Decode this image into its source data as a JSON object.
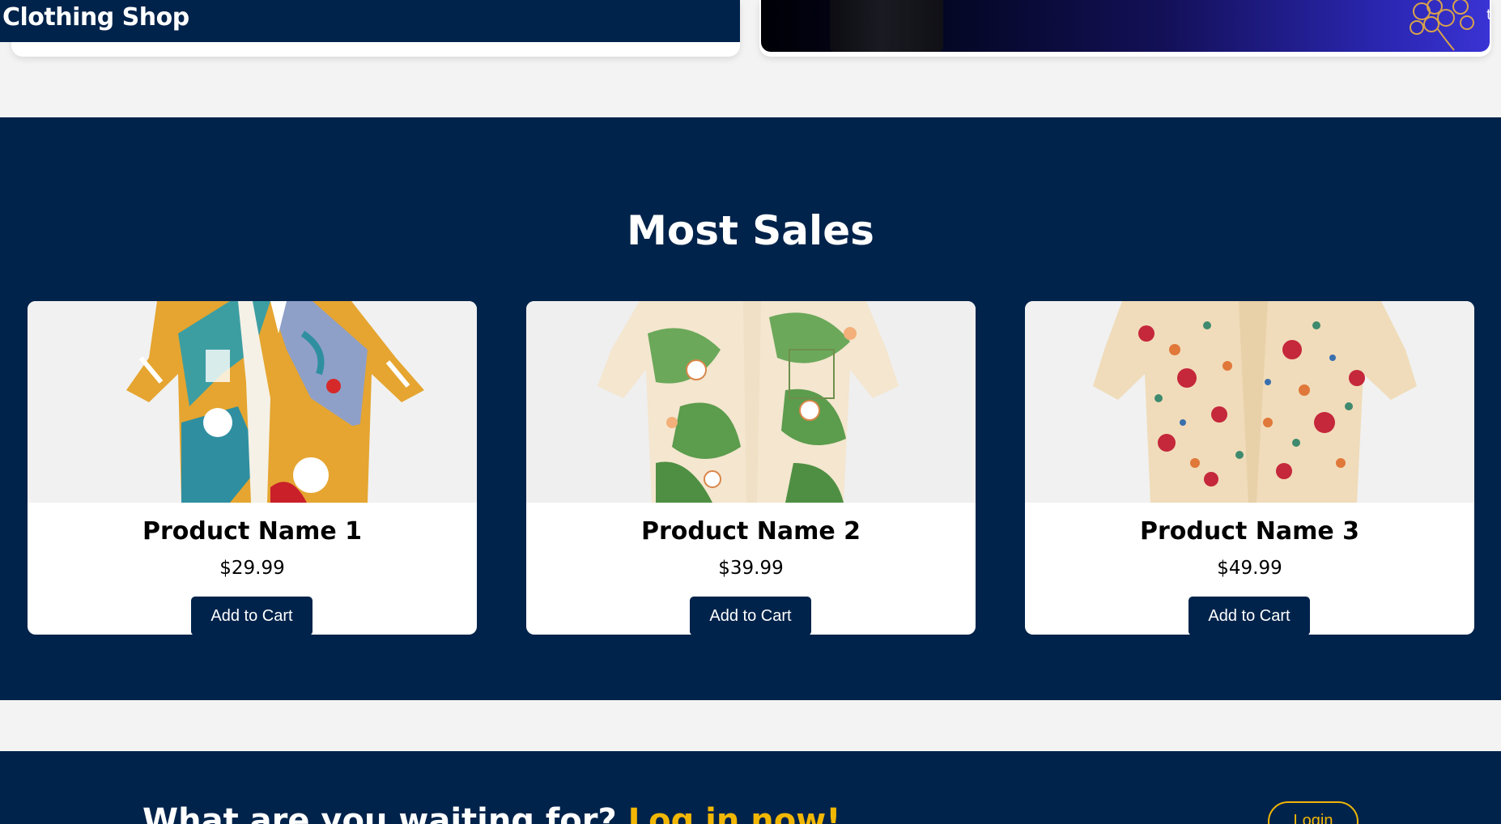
{
  "header": {
    "brand": "Clothing Shop"
  },
  "hero": {
    "edge_text": "t"
  },
  "sales": {
    "title": "Most Sales",
    "products": [
      {
        "name": "Product Name 1",
        "price": "$29.99",
        "button": "Add to Cart",
        "image_icon": "shirt-image-abstract-print"
      },
      {
        "name": "Product Name 2",
        "price": "$39.99",
        "button": "Add to Cart",
        "image_icon": "shirt-image-lily-print"
      },
      {
        "name": "Product Name 3",
        "price": "$49.99",
        "button": "Add to Cart",
        "image_icon": "shirt-image-rose-print"
      }
    ]
  },
  "cta": {
    "text": "What are you waiting for?",
    "highlight": "Log in now!",
    "button": "Login"
  },
  "colors": {
    "navy": "#00234b",
    "accent_yellow": "#f2b705",
    "page_bg": "#f3f3f3"
  }
}
